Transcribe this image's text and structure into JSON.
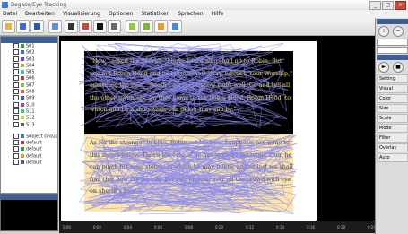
{
  "window": {
    "title": "Begaze/Eye Tracking"
  },
  "menu": {
    "items": [
      "Datei",
      "Bearbeiten",
      "Visualisierung",
      "Optionen",
      "Statistiken",
      "Sprachen",
      "Hilfe"
    ]
  },
  "left_panel": {
    "tree": [
      {
        "label": "S01",
        "color": "#3a9b3a"
      },
      {
        "label": "S02",
        "color": "#3a78c8"
      },
      {
        "label": "S03",
        "color": "#7a3ac8"
      },
      {
        "label": "S04",
        "color": "#c8a33a"
      },
      {
        "label": "S05",
        "color": "#3ac8c0"
      },
      {
        "label": "S06",
        "color": "#c83a3a"
      },
      {
        "label": "S07",
        "color": "#8ac83a"
      },
      {
        "label": "S08",
        "color": "#c86a3a"
      },
      {
        "label": "S09",
        "color": "#3a5ac8"
      },
      {
        "label": "S10",
        "color": "#a83ac8"
      },
      {
        "label": "S11",
        "color": "#3ac87a"
      },
      {
        "label": "S12",
        "color": "#c8c83a"
      },
      {
        "label": "S13",
        "color": "#5a5a5a"
      },
      {
        "label": "Subject Group",
        "color": "#3a78c8"
      },
      {
        "label": "default",
        "color": "#c83a3a"
      },
      {
        "label": "default",
        "color": "#3a9b3a"
      },
      {
        "label": "default",
        "color": "#c8a33a"
      },
      {
        "label": "default",
        "color": "#3a5ac8"
      }
    ]
  },
  "text": {
    "p1": "\"Now,\" asked the Sheriff, \"I have heard who shall go to Robin. But you are Robin Hood and no better one.\" \"Nay, I doubt, Your Worship,\" answered the man, \"Sooth I confess I know right well. Go and tell all the other inventors. So they come to the Robin Hood. Robin Hood, to watch and by a side, while our tinker may slip by.\"",
    "p2": "As for the stranger in blue, Robin set his bow. I suppose, are none to this merry fellow. That's the rule, if he has stopped the wine. Then he can pinch his nose stoutly in which he may follow, and at last we shall find that how the lot may fall out, looking over all the crowd with eye on sheriff's face."
  },
  "timeline": {
    "ticks": [
      "0:00",
      "0:02",
      "0:04",
      "0:06",
      "0:08",
      "0:10",
      "0:12",
      "0:14",
      "0:16",
      "0:18",
      "0:20"
    ]
  },
  "right_panel": {
    "rows": [
      "Setting",
      "Visual",
      "Color",
      "Size",
      "Scale",
      "Mode",
      "Filter",
      "Overlay",
      "Auto"
    ]
  },
  "colors": {
    "accent": "#3d5f93",
    "aoi_light": "#fde6a8",
    "gaze": "#8a8af0"
  }
}
